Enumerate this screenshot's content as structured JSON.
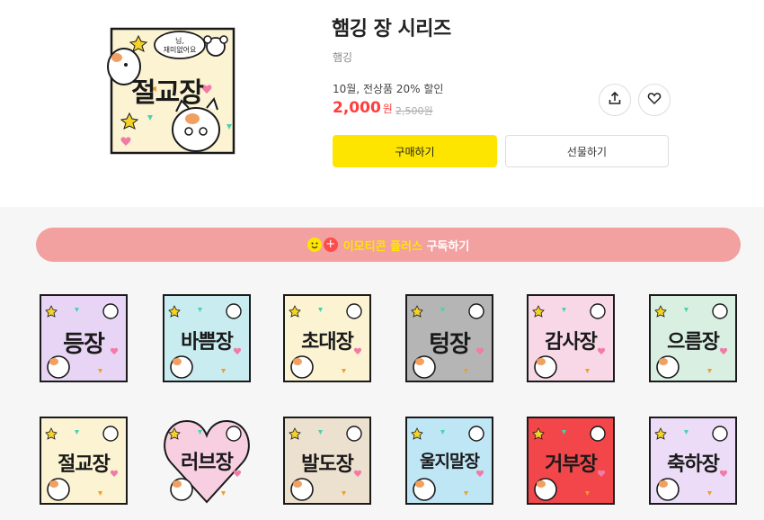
{
  "product": {
    "title": "햄깅 장 시리즈",
    "author": "햄깅",
    "promo": "10월, 전상품 20% 할인",
    "price": "2,000",
    "price_unit": "원",
    "original_price": "2,500원",
    "hero_label": "절교장",
    "hero_bubble": "님, 재미없어요"
  },
  "actions": {
    "buy": "구매하기",
    "gift": "선물하기",
    "share_icon": "share-icon",
    "like_icon": "heart-icon"
  },
  "subscription": {
    "highlight": "이모티콘 플러스",
    "text": " 구독하기"
  },
  "stickers": [
    {
      "label": "등장",
      "bg": "#e8d5f5",
      "shape": "square"
    },
    {
      "label": "바쁨장",
      "bg": "#c8ecf0",
      "shape": "square"
    },
    {
      "label": "초대장",
      "bg": "#fbf3d2",
      "shape": "square"
    },
    {
      "label": "텅장",
      "bg": "#b5b5b5",
      "shape": "square"
    },
    {
      "label": "감사장",
      "bg": "#f8d8e6",
      "shape": "square"
    },
    {
      "label": "으름장",
      "bg": "#d8efe2",
      "shape": "square"
    },
    {
      "label": "절교장",
      "bg": "#fbf3d2",
      "shape": "square"
    },
    {
      "label": "러브장",
      "bg": "#f8cfe0",
      "shape": "heart"
    },
    {
      "label": "발도장",
      "bg": "#ece0cf",
      "shape": "square"
    },
    {
      "label": "울지말장",
      "bg": "#bfe6f5",
      "shape": "square"
    },
    {
      "label": "거부장",
      "bg": "#f2464a",
      "shape": "square"
    },
    {
      "label": "축하장",
      "bg": "#ecdcf8",
      "shape": "square"
    }
  ]
}
